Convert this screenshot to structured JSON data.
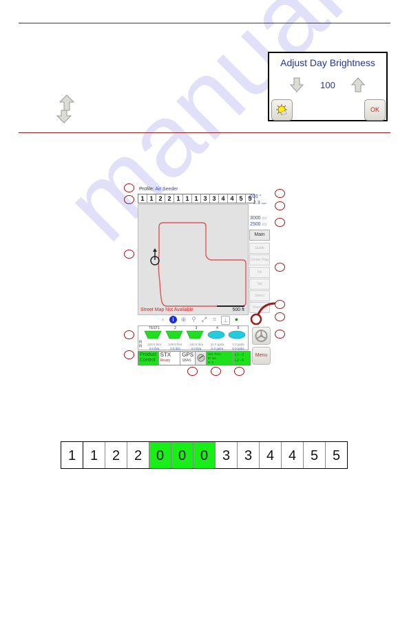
{
  "watermark": "manualslib.com",
  "brightness_dialog": {
    "title": "Adjust Day Brightness",
    "value": "100",
    "ok_label": "OK",
    "icons": [
      "down-arrow-icon",
      "up-arrow-icon",
      "sun-icon"
    ]
  },
  "legend_arrows": [
    "up-arrow-icon",
    "down-arrow-icon"
  ],
  "console": {
    "profile_label": "Profile:",
    "profile_name": "Air Seeder",
    "section_bar": [
      "1",
      "1",
      "2",
      "2",
      "1",
      "1",
      "1",
      "3",
      "3",
      "4",
      "4",
      "5",
      "5"
    ],
    "heading": "010 °",
    "speed": "2.3",
    "speed_units": "mph",
    "area_totals": [
      "3000",
      "2500"
    ],
    "map_message": "Street Map Not Available",
    "scale_label": "500 ft",
    "side_tabs": [
      "Main",
      "Guide",
      "Center Flag",
      "Fix",
      "Set",
      "Select",
      "Overview"
    ],
    "toolbar_icons": [
      "tractor-icon",
      "info-icon",
      "target-icon",
      "zoom-in-icon",
      "zoom-extent-icon",
      "grid-icon",
      "boom-icon",
      "gps-globe-icon"
    ],
    "products": [
      {
        "name": "TEST1",
        "type": "dry",
        "rate": "100.0 lb/a",
        "actual": "0.0 lb/a",
        "color": "#22dd22"
      },
      {
        "name": "2",
        "type": "dry",
        "rate": "100.0 lb/a",
        "actual": "0.0 lb/a",
        "color": "#22dd22"
      },
      {
        "name": "3",
        "type": "dry",
        "rate": "100.0 lb/a",
        "actual": "0.0 lb/a",
        "color": "#22dd22"
      },
      {
        "name": "4",
        "type": "liquid",
        "rate": "10.0 gal/a",
        "actual": "0.0 gal/a",
        "color": "#22ccdd"
      },
      {
        "name": "5",
        "type": "liquid",
        "rate": "1.0 gal/a",
        "actual": "0.0 gal/a",
        "color": "#22ccdd"
      }
    ],
    "row_labels": [
      "R",
      "R"
    ],
    "status": {
      "product_control": "Product Control",
      "stx": "STX",
      "stx_state": "Ready",
      "gps": "GPS",
      "gps_mode": "SBAS",
      "header_title": "Hdr. Pres.",
      "header_line1": "R: set",
      "header_line2": "R: 0",
      "lane1": "L1 - 3",
      "lane2": "L2 - 5"
    },
    "menu_label": "Menu"
  },
  "section_bar_example": {
    "cells": [
      "1",
      "1",
      "2",
      "2",
      "0",
      "0",
      "0",
      "3",
      "3",
      "4",
      "4",
      "5",
      "5"
    ],
    "highlighted": [
      false,
      false,
      false,
      false,
      true,
      true,
      true,
      false,
      false,
      false,
      false,
      false,
      false
    ],
    "highlight_color": "#18ee18"
  },
  "colors": {
    "rule": "#8b1a1a",
    "callout": "#a01818",
    "dialog_text": "#2233aa",
    "ok_text": "#d02020"
  }
}
